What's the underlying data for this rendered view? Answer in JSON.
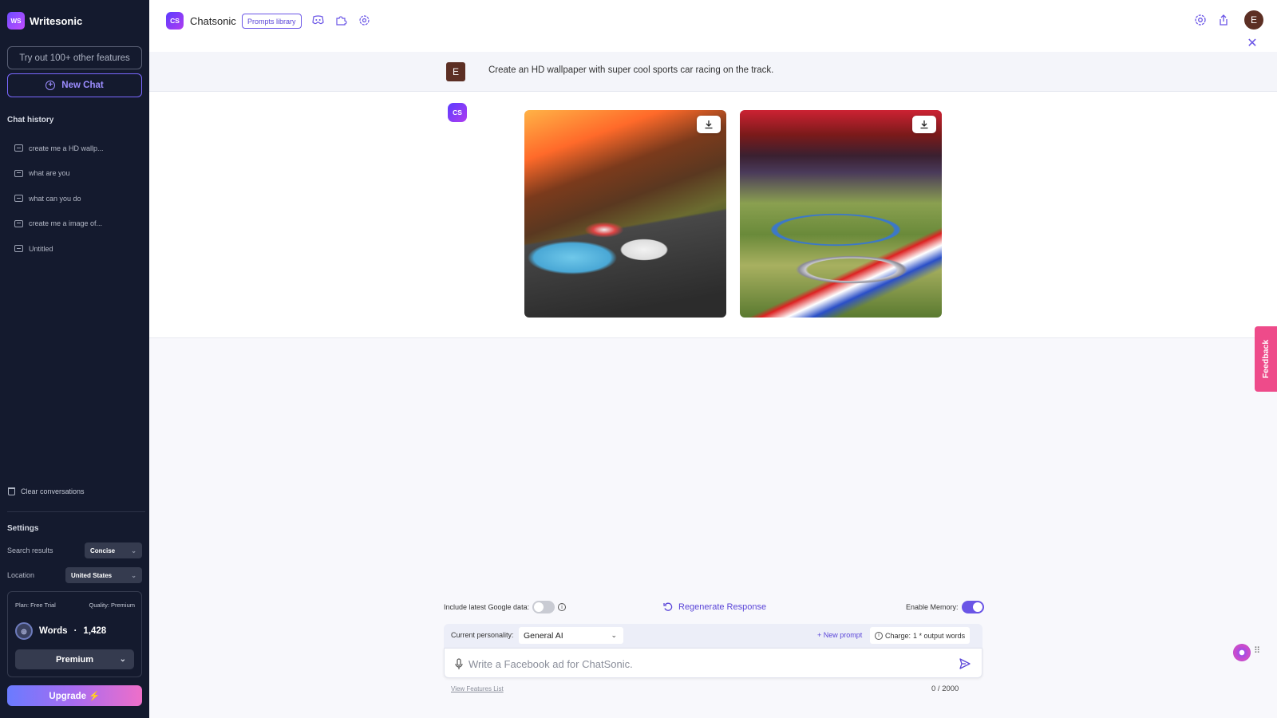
{
  "sidebar": {
    "brand_logo": "WS",
    "brand_name": "Writesonic",
    "try_label": "Try out 100+ other features",
    "new_chat_label": "New Chat",
    "history_title": "Chat history",
    "history": [
      {
        "label": "create me a HD wallp..."
      },
      {
        "label": "what are you"
      },
      {
        "label": "what can you do"
      },
      {
        "label": "create me a image of..."
      },
      {
        "label": "Untitled"
      }
    ],
    "clear_label": "Clear conversations",
    "settings_title": "Settings",
    "search_results_label": "Search results",
    "search_results_value": "Concise",
    "location_label": "Location",
    "location_value": "United States",
    "plan_label": "Plan: Free Trial",
    "quality_label": "Quality: Premium",
    "words_label": "Words",
    "words_sep": "·",
    "words_value": "1,428",
    "premium_value": "Premium",
    "upgrade_label": "Upgrade ⚡"
  },
  "header": {
    "logo": "CS",
    "title": "Chatsonic",
    "prompts_library": "Prompts library",
    "icons": [
      "discord-icon",
      "plugin-icon",
      "settings-icon",
      "gear-icon",
      "share-icon",
      "close-icon"
    ],
    "avatar_initial": "E"
  },
  "conversation": {
    "user_initial": "E",
    "user_message": "Create an HD wallpaper with super cool sports car racing on the track.",
    "bot_logo": "CS",
    "images": [
      {
        "alt": "sports cars racing on mountain track at sunset"
      },
      {
        "alt": "winding race track through colorful hills"
      }
    ]
  },
  "feedback_label": "Feedback",
  "composer": {
    "google_label": "Include latest Google data:",
    "google_enabled": false,
    "regenerate_label": "Regenerate Response",
    "memory_label": "Enable Memory:",
    "memory_enabled": true,
    "personality_label": "Current personality:",
    "personality_value": "General AI",
    "new_prompt_label": "+ New prompt",
    "charge_label": "Charge:",
    "charge_value": "1 * output words",
    "input_placeholder": "Write a Facebook ad for ChatSonic.",
    "view_features": "View Features List",
    "counter": "0 / 2000"
  },
  "colors": {
    "sidebar_bg": "#141a2e",
    "accent": "#6a55e6",
    "feedback": "#ee4b8a"
  }
}
